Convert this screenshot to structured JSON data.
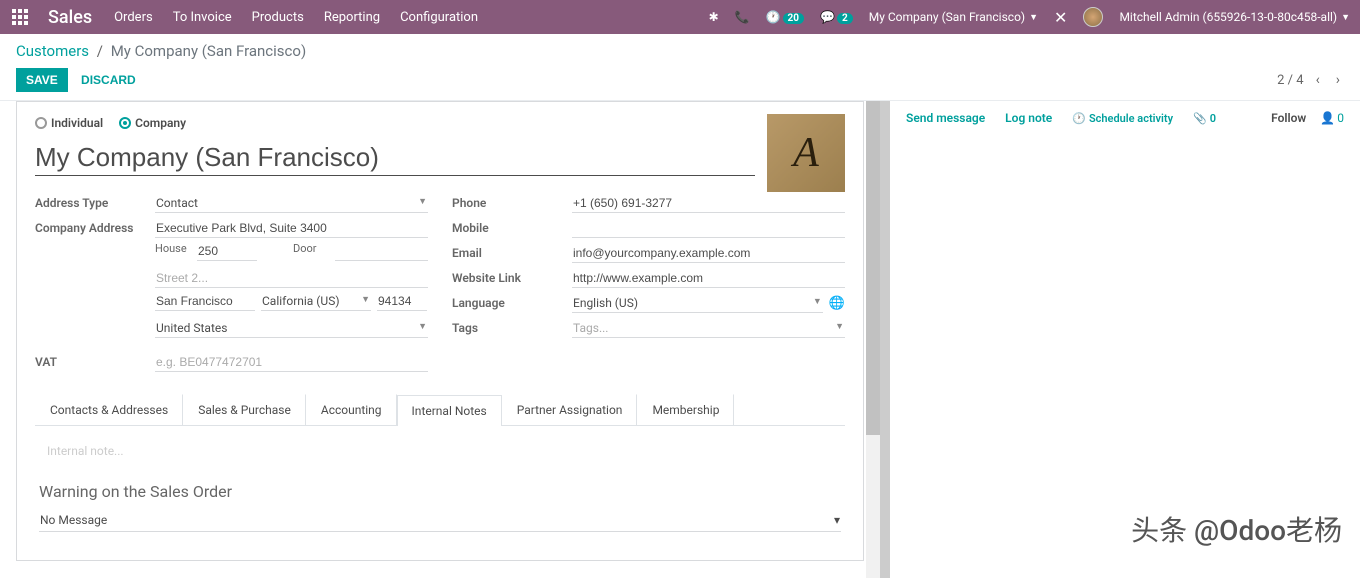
{
  "nav": {
    "brand": "Sales",
    "menu": [
      "Orders",
      "To Invoice",
      "Products",
      "Reporting",
      "Configuration"
    ],
    "clock_badge": "20",
    "chat_badge": "2",
    "company": "My Company (San Francisco)",
    "user": "Mitchell Admin (655926-13-0-80c458-all)"
  },
  "breadcrumb": {
    "parent": "Customers",
    "current": "My Company (San Francisco)"
  },
  "buttons": {
    "save": "Save",
    "discard": "Discard"
  },
  "pager": {
    "pos": "2 / 4"
  },
  "form": {
    "type_individual": "Individual",
    "type_company": "Company",
    "name": "My Company (San Francisco)",
    "labels": {
      "address_type": "Address Type",
      "company_address": "Company Address",
      "vat": "VAT",
      "phone": "Phone",
      "mobile": "Mobile",
      "email": "Email",
      "website": "Website Link",
      "language": "Language",
      "tags": "Tags"
    },
    "address_type_val": "Contact",
    "street": "Executive Park Blvd, Suite 3400",
    "house_label": "House",
    "house": "250",
    "door_label": "Door",
    "door": "",
    "street2_ph": "Street 2...",
    "city": "San Francisco",
    "state": "California (US)",
    "zip": "94134",
    "country": "United States",
    "vat_ph": "e.g. BE0477472701",
    "phone": "+1 (650) 691-3277",
    "mobile": "",
    "email": "info@yourcompany.example.com",
    "website": "http://www.example.com",
    "language": "English (US)",
    "tags_ph": "Tags..."
  },
  "tabs": [
    "Contacts & Addresses",
    "Sales & Purchase",
    "Accounting",
    "Internal Notes",
    "Partner Assignation",
    "Membership"
  ],
  "tab_active_index": 3,
  "notes": {
    "placeholder": "Internal note...",
    "warning_title": "Warning on the Sales Order",
    "warning_val": "No Message"
  },
  "chatter": {
    "send": "Send message",
    "lognote": "Log note",
    "schedule": "Schedule activity",
    "attach_count": "0",
    "follow": "Follow",
    "followers": "0"
  },
  "watermark": "头条 @Odoo老杨"
}
